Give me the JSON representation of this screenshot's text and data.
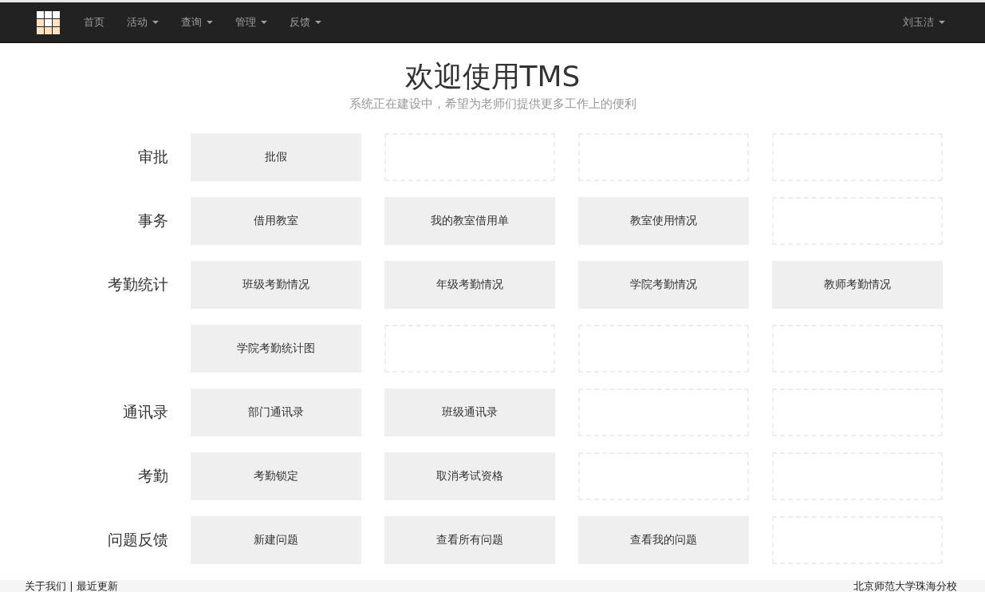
{
  "navbar": {
    "menu": [
      {
        "label": "首页",
        "dropdown": false
      },
      {
        "label": "活动",
        "dropdown": true
      },
      {
        "label": "查询",
        "dropdown": true
      },
      {
        "label": "管理",
        "dropdown": true
      },
      {
        "label": "反馈",
        "dropdown": true
      }
    ],
    "user": {
      "label": "刘玉洁",
      "dropdown": true
    }
  },
  "header": {
    "title": "欢迎使用TMS",
    "subtitle": "系统正在建设中，希望为老师们提供更多工作上的便利"
  },
  "rows": [
    {
      "label": "审批",
      "cells": [
        {
          "kind": "button",
          "label": "批假"
        },
        {
          "kind": "empty"
        },
        {
          "kind": "empty"
        },
        {
          "kind": "empty"
        }
      ]
    },
    {
      "label": "事务",
      "cells": [
        {
          "kind": "button",
          "label": "借用教室"
        },
        {
          "kind": "button",
          "label": "我的教室借用单"
        },
        {
          "kind": "button",
          "label": "教室使用情况"
        },
        {
          "kind": "empty"
        }
      ]
    },
    {
      "label": "考勤统计",
      "cells": [
        {
          "kind": "button",
          "label": "班级考勤情况"
        },
        {
          "kind": "button",
          "label": "年级考勤情况"
        },
        {
          "kind": "button",
          "label": "学院考勤情况"
        },
        {
          "kind": "button",
          "label": "教师考勤情况"
        }
      ]
    },
    {
      "cells": [
        {
          "kind": "button",
          "label": "学院考勤统计图"
        },
        {
          "kind": "empty"
        },
        {
          "kind": "empty"
        },
        {
          "kind": "empty"
        }
      ]
    },
    {
      "label": "通讯录",
      "cells": [
        {
          "kind": "button",
          "label": "部门通讯录"
        },
        {
          "kind": "button",
          "label": "班级通讯录"
        },
        {
          "kind": "empty"
        },
        {
          "kind": "empty"
        }
      ]
    },
    {
      "label": "考勤",
      "cells": [
        {
          "kind": "button",
          "label": "考勤锁定"
        },
        {
          "kind": "button",
          "label": "取消考试资格"
        },
        {
          "kind": "empty"
        },
        {
          "kind": "empty"
        }
      ]
    },
    {
      "label": "问题反馈",
      "cells": [
        {
          "kind": "button",
          "label": "新建问题"
        },
        {
          "kind": "button",
          "label": "查看所有问题"
        },
        {
          "kind": "button",
          "label": "查看我的问题"
        },
        {
          "kind": "empty"
        }
      ]
    }
  ],
  "footer": {
    "links": "关于我们 | 最近更新",
    "school": "北京师范大学珠海分校"
  }
}
